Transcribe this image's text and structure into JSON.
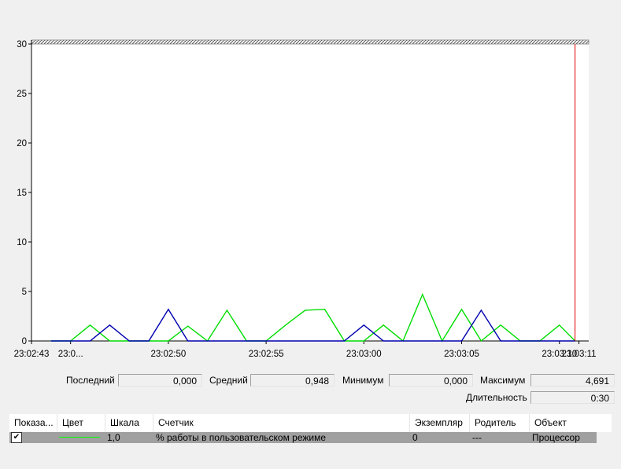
{
  "chart_data": {
    "type": "line",
    "ylim": [
      0,
      30
    ],
    "y_ticks": [
      "30",
      "25",
      "20",
      "15",
      "10",
      "5",
      "0"
    ],
    "x_ticks": [
      {
        "label": "23:02:43",
        "t": 0
      },
      {
        "label": "23:0...",
        "t": 2
      },
      {
        "label": "23:02:50",
        "t": 7
      },
      {
        "label": "23:02:55",
        "t": 12
      },
      {
        "label": "23:03:00",
        "t": 17
      },
      {
        "label": "23:03:05",
        "t": 22
      },
      {
        "label": "23:03:10",
        "t": 27
      },
      {
        "label": "23:03:11",
        "t": 28
      }
    ],
    "x_range": [
      0,
      28.5
    ],
    "current_time_marker": 27.8,
    "grid": false,
    "series": [
      {
        "color": "#00dd00",
        "points": [
          [
            1,
            0
          ],
          [
            2,
            0
          ],
          [
            3,
            1.6
          ],
          [
            4,
            0
          ],
          [
            5,
            0
          ],
          [
            6,
            0
          ],
          [
            7,
            0
          ],
          [
            8,
            1.5
          ],
          [
            9,
            0
          ],
          [
            10,
            3.1
          ],
          [
            11,
            0
          ],
          [
            12,
            0
          ],
          [
            13,
            1.6
          ],
          [
            14,
            3.1
          ],
          [
            15,
            3.2
          ],
          [
            16,
            0
          ],
          [
            17,
            0
          ],
          [
            18,
            1.6
          ],
          [
            19,
            0
          ],
          [
            20,
            4.7
          ],
          [
            21,
            0
          ],
          [
            22,
            3.2
          ],
          [
            23,
            0
          ],
          [
            24,
            1.6
          ],
          [
            25,
            0
          ],
          [
            26,
            0
          ],
          [
            27,
            1.6
          ],
          [
            27.8,
            0
          ]
        ]
      },
      {
        "color": "#0000b0",
        "points": [
          [
            1,
            0
          ],
          [
            2,
            0
          ],
          [
            3,
            0
          ],
          [
            4,
            1.6
          ],
          [
            5,
            0
          ],
          [
            6,
            0
          ],
          [
            7,
            3.2
          ],
          [
            8,
            0
          ],
          [
            9,
            0
          ],
          [
            10,
            0
          ],
          [
            11,
            0
          ],
          [
            12,
            0
          ],
          [
            13,
            0
          ],
          [
            14,
            0
          ],
          [
            15,
            0
          ],
          [
            16,
            0
          ],
          [
            17,
            1.6
          ],
          [
            18,
            0
          ],
          [
            19,
            0
          ],
          [
            20,
            0
          ],
          [
            21,
            0
          ],
          [
            22,
            0
          ],
          [
            23,
            3.1
          ],
          [
            24,
            0
          ],
          [
            25,
            0
          ],
          [
            26,
            0
          ],
          [
            27,
            0
          ],
          [
            27.8,
            0
          ]
        ]
      }
    ]
  },
  "stats": {
    "last_label": "Последний",
    "last_value": "0,000",
    "avg_label": "Средний",
    "avg_value": "0,948",
    "min_label": "Минимум",
    "min_value": "0,000",
    "max_label": "Максимум",
    "max_value": "4,691",
    "duration_label": "Длительность",
    "duration_value": "0:30"
  },
  "legend": {
    "headers": {
      "show": "Показа...",
      "color": "Цвет",
      "scale": "Шкала",
      "counter": "Счетчик",
      "instance": "Экземпляр",
      "parent": "Родитель",
      "object": "Объект"
    },
    "row": {
      "checked": "✔",
      "color": "#00ff00",
      "scale": "1,0",
      "counter": "% работы в пользовательском режиме",
      "instance": "0",
      "parent": "---",
      "object": "Процессор"
    }
  }
}
